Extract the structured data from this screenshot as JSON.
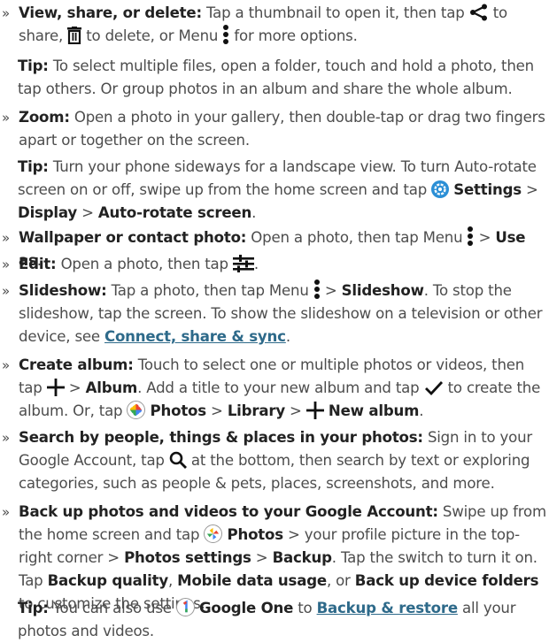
{
  "items": {
    "view": {
      "title": "View, share, or delete:",
      "t1": "Tap a thumbnail to open it, then tap",
      "t2": "to share,",
      "t3": "to delete, or Menu",
      "t4": "for more options."
    },
    "tip1": {
      "label": "Tip:",
      "text": "To select multiple files, open a folder, touch and hold a photo, then tap others. Or group photos in an album and share the whole album."
    },
    "zoom": {
      "title": "Zoom:",
      "text": "Open a photo in your gallery, then double-tap or drag two fingers apart or together on the screen."
    },
    "tip2": {
      "label": "Tip:",
      "text": "Turn your phone sideways for a landscape view. To turn Auto-rotate screen on or off, swipe up from the home screen and tap",
      "settings": "Settings",
      "sep1": ">",
      "display": "Display",
      "sep2": ">",
      "auto_rotate": "Auto-rotate screen",
      "end": "."
    },
    "wallpaper": {
      "title": "Wallpaper or contact photo:",
      "t1": "Open a photo, then tap Menu",
      "sep": ">",
      "use_as": "Use as",
      "end": "."
    },
    "edit": {
      "title": "Edit:",
      "text": "Open a photo, then tap",
      "end": "."
    },
    "slideshow": {
      "title": "Slideshow:",
      "t1": "Tap a photo, then tap Menu",
      "sep": ">",
      "slideshow": "Slideshow",
      "t2": ". To stop the slideshow, tap the screen. To show the slideshow on a television or other device, see",
      "link": "Connect, share & sync",
      "end": "."
    },
    "album": {
      "title": "Create album:",
      "t1": "Touch to select one or multiple photos or videos, then tap",
      "sep1": ">",
      "album": "Album",
      "t2": ". Add a title to your new album and tap",
      "t3": "to create the album. Or, tap",
      "photos": "Photos",
      "sep2": ">",
      "library": "Library",
      "sep3": ">",
      "new_album": "New album",
      "end": "."
    },
    "search": {
      "title": "Search by people, things & places in your photos:",
      "t1": "Sign in to your Google Account, tap",
      "t2": "at the bottom, then search by text or exploring categories, such as people & pets, places, screenshots, and more."
    },
    "backup": {
      "title": "Back up photos and videos to your Google Account:",
      "t1": "Swipe up from the home screen and tap",
      "photos": "Photos",
      "t2": "> your profile picture in the top-right corner >",
      "photos_settings": "Photos settings",
      "sep": ">",
      "backup": "Backup",
      "t3": ". Tap the switch to turn it on. Tap",
      "quality": "Backup quality",
      "comma": ",",
      "mobile": "Mobile data usage",
      "or": ", or",
      "folders": "Back up device folders",
      "t4": "to customize the settings."
    },
    "tip3": {
      "label": "Tip:",
      "t1": "You can also use",
      "google_one": "Google One",
      "t2": "to",
      "link": "Backup & restore",
      "t3": "all your photos and videos."
    }
  },
  "bullet_mark": "»",
  "colors": {
    "text": "#4d4d4d",
    "bold": "#222222",
    "link": "#2e6a8a"
  }
}
